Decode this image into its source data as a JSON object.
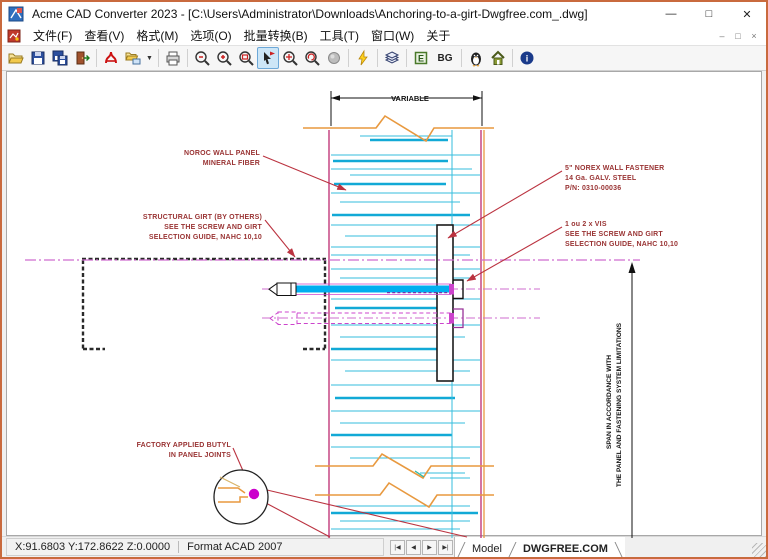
{
  "window": {
    "title": "Acme CAD Converter 2023 - [C:\\Users\\Administrator\\Downloads\\Anchoring-to-a-girt-Dwgfree.com_.dwg]",
    "controls": {
      "minimize": "—",
      "maximize": "□",
      "close": "✕"
    }
  },
  "menu": {
    "items": [
      "文件(F)",
      "查看(V)",
      "格式(M)",
      "选项(O)",
      "批量转换(B)",
      "工具(T)",
      "窗口(W)",
      "关于"
    ],
    "mdi": {
      "minimize": "–",
      "restore": "□",
      "close": "×"
    }
  },
  "toolbar": {
    "buttons": [
      "open",
      "save",
      "save-all",
      "close-file",
      "export-pdf",
      "batch-convert",
      "print",
      "zoom-out",
      "zoom-in",
      "zoom-window",
      "zoom-extents",
      "zoom-previous",
      "zoom-rotate",
      "shade-mode",
      "match",
      "layers",
      "viewport",
      "background-color",
      "fonts",
      "home",
      "info"
    ],
    "active_button": "zoom-extents",
    "caret": "▼",
    "bg_label": "BG",
    "viewport_letter": "E",
    "info_letter": "i"
  },
  "drawing": {
    "dim_variable": "VARIABLE",
    "ann_panel_1": "NOROC WALL PANEL",
    "ann_panel_2": "MINERAL FIBER",
    "ann_girt_1": "STRUCTURAL GIRT (BY OTHERS)",
    "ann_girt_2": "SEE THE SCREW AND GIRT",
    "ann_girt_3": "SELECTION GUIDE, NAHC 10,10",
    "ann_fastener_1": "5\" NOREX WALL FASTENER",
    "ann_fastener_2": "14 Ga. GALV. STEEL",
    "ann_fastener_3": "P/N: 0310-00036",
    "ann_vis_1": "1 ou 2 x VIS",
    "ann_vis_2": "SEE THE SCREW AND GIRT",
    "ann_vis_3": "SELECTION GUIDE, NAHC 10,10",
    "ann_butyl_1": "FACTORY APPLIED BUTYL",
    "ann_butyl_2": "IN PANEL JOINTS",
    "dim_span_1": "SPAN IN ACCORDANCE WITH",
    "dim_span_2": "THE PANEL AND FASTENING SYSTEM LIMITATIONS",
    "colors": {
      "panel_hatch_cyan": "#35bede",
      "panel_edge_magenta": "#c23a7a",
      "break_line_orange": "#e8993f",
      "centerline_magenta": "#cf6ccf",
      "screw_cyan": "#00aeef",
      "leader_red": "#bb3340",
      "annotation_text": "#993333",
      "butyl_magenta": "#cc00cc"
    }
  },
  "statusbar": {
    "coordinates": "X:91.6803 Y:172.8622 Z:0.0000",
    "format": "Format ACAD 2007",
    "nav": [
      "|◀",
      "◀",
      "▶",
      "▶|"
    ],
    "tabs": [
      {
        "label": "Model",
        "active": false
      },
      {
        "label": "DWGFREE.COM",
        "active": true
      }
    ]
  }
}
